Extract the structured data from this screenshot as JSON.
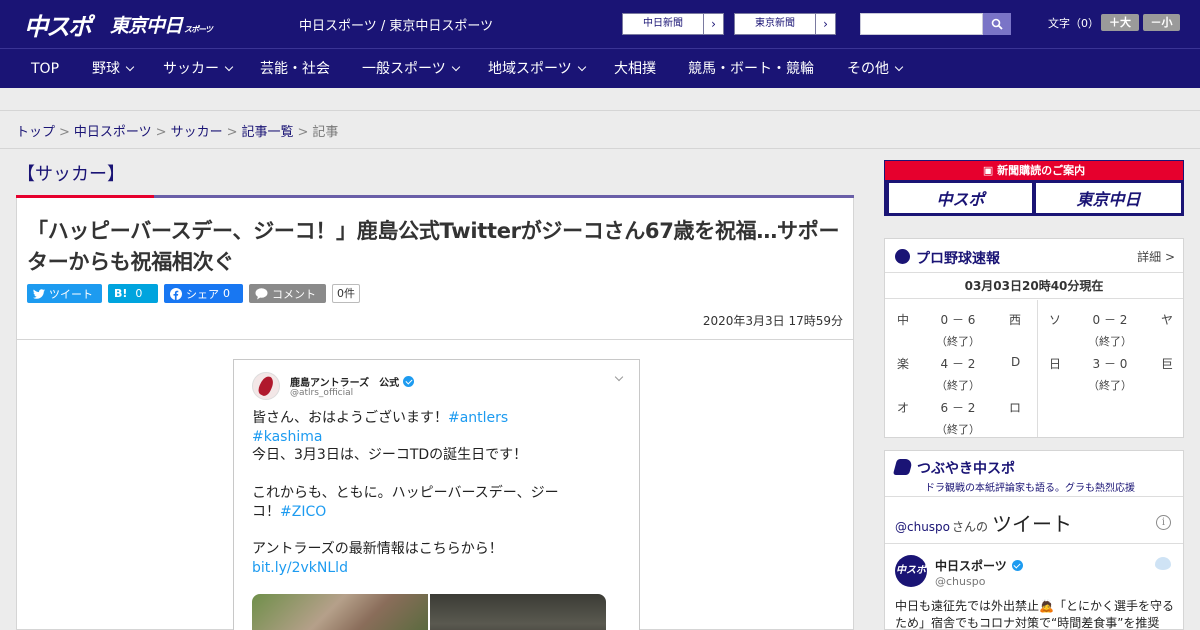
{
  "header": {
    "logo_chuspo": "中スポ",
    "logo_tokyo": "東京中日",
    "logo_tokyo_small": "スポーツ",
    "site_title": "中日スポーツ / 東京中日スポーツ",
    "paper_chunichi": "中日新聞",
    "paper_tokyo": "東京新聞",
    "paper_arrow": "›",
    "search_placeholder": "",
    "fontsize_label": "文字（0）",
    "fontsize_up": "＋大",
    "fontsize_down": "－小"
  },
  "nav": {
    "items": [
      "TOP",
      "野球",
      "サッカー",
      "芸能・社会",
      "一般スポーツ",
      "地域スポーツ",
      "大相撲",
      "競馬・ボート・競輪",
      "その他"
    ]
  },
  "breadcrumb": {
    "items": [
      "トップ",
      "中日スポーツ",
      "サッカー",
      "記事一覧"
    ],
    "current": "記事",
    "sep": ">"
  },
  "article": {
    "category": "【サッカー】",
    "headline": "「ハッピーバースデー、ジーコ！」鹿島公式Twitterがジーコさん67歳を祝福…サポーターからも祝福相次ぐ",
    "share_twitter": "ツイート",
    "share_hatena_icon": "B!",
    "share_hatena_count": "0",
    "share_facebook": "シェア",
    "share_facebook_count": "0",
    "share_comment": "コメント",
    "comment_count": "0件",
    "date": "2020年3月3日 17時59分"
  },
  "tweet_image": {
    "name": "鹿島アントラーズ　公式",
    "handle": "@atlrs_official",
    "line1": "皆さん、おはようございます！",
    "line1_tags": "#antlers #kashima",
    "line2": "今日、3月3日は、ジーコTDの誕生日です！",
    "line3": "これからも、ともに。ハッピーバースデー、ジー",
    "line4": "コ！",
    "line4_tag": "#ZICO",
    "line5": "アントラーズの最新情報はこちらから！",
    "line6": "bit.ly/2vkNLld"
  },
  "promo": {
    "title": "新聞購読のご案内",
    "btn1": "中スポ",
    "btn2": "東京中日"
  },
  "baseball": {
    "title": "プロ野球速報",
    "detail": "詳細 >",
    "time": "03月03日20時40分現在",
    "games": [
      {
        "home": "中",
        "score": "0 － 6",
        "away": "西",
        "status": "（終了）"
      },
      {
        "home": "ソ",
        "score": "0 － 2",
        "away": "ヤ",
        "status": "（終了）"
      },
      {
        "home": "楽",
        "score": "4 － 2",
        "away": "D",
        "status": "（終了）"
      },
      {
        "home": "日",
        "score": "3 － 0",
        "away": "巨",
        "status": "（終了）"
      },
      {
        "home": "オ",
        "score": "6 － 2",
        "away": "ロ",
        "status": "（終了）"
      }
    ]
  },
  "tsubuyaki": {
    "title": "つぶやき中スポ",
    "subtitle": "ドラ観戦の本紙評論家も語る。グラも熱烈応援",
    "handle": "@chuspo",
    "san": "さんの",
    "tweet_word": "ツイート",
    "info": "i",
    "account_name": "中日スポーツ",
    "account_handle": "@chuspo",
    "avatar_text": "中スポ",
    "tweet_text": "中日も遠征先では外出禁止🙇「とにかく選手を守るため」宿舎でもコロナ対策で“時間差食事”を推奨"
  },
  "colors": {
    "brand_navy": "#1a1475",
    "accent_red": "#e6002d",
    "twitter_blue": "#1d9bf0"
  }
}
